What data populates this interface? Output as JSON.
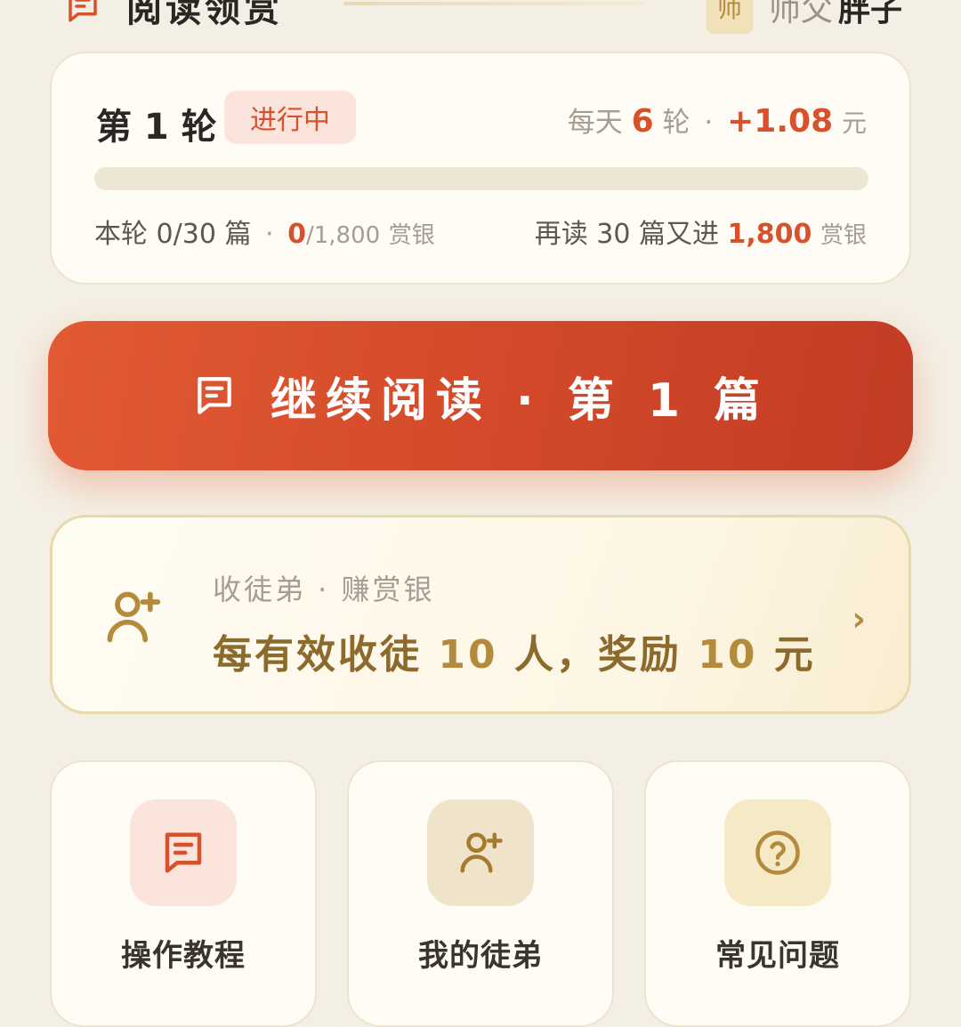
{
  "header": {
    "title": "阅读领赏",
    "master_badge": "师",
    "master_label": "师父",
    "master_name": "胖子"
  },
  "round": {
    "title": "第 1 轮",
    "status": "进行中",
    "daily_prefix": "每天",
    "daily_rounds": "6",
    "daily_rounds_unit": "轮",
    "separator": "·",
    "daily_reward": "+1.08",
    "daily_reward_unit": "元",
    "progress_fraction": 0,
    "stat_left_prefix": "本轮 0/30 篇",
    "stat_left_earned": "0",
    "stat_left_total": "/1,800",
    "stat_left_unit": "赏银",
    "stat_right_prefix": "再读 30 篇又进",
    "stat_right_amount": "1,800",
    "stat_right_unit": "赏银"
  },
  "cta": {
    "label": "继续阅读 · 第 1 篇",
    "icon": "article-icon"
  },
  "invite": {
    "subtitle": "收徒弟 · 赚赏银",
    "main_prefix": "每有效收徒",
    "main_count": "10",
    "main_mid": "人，奖励",
    "main_amount": "10",
    "main_suffix": "元",
    "chevron": "›",
    "icon": "add-user-icon"
  },
  "tiles": [
    {
      "label": "操作教程",
      "icon": "tutorial-icon",
      "bg": "#fbe4dc",
      "color": "#d8512d"
    },
    {
      "label": "我的徒弟",
      "icon": "apprentice-icon",
      "bg": "#efe3c9",
      "color": "#a67a2c"
    },
    {
      "label": "常见问题",
      "icon": "question-icon",
      "bg": "#f6e9c6",
      "color": "#b48a3d"
    }
  ],
  "colors": {
    "accent": "#d8512d",
    "gold": "#b48a3d",
    "background": "#f4efe4"
  }
}
